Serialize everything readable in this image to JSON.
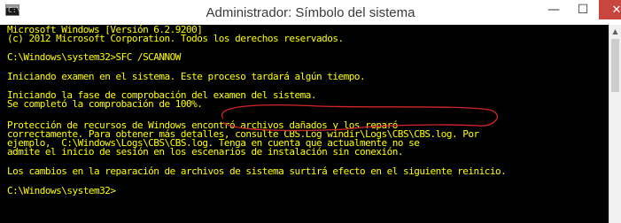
{
  "window": {
    "title": "Administrador: Símbolo del sistema",
    "icon_glyph": "C:\\",
    "minimize_glyph": "—",
    "maximize_glyph": "☐",
    "close_glyph": "✕"
  },
  "console": {
    "text_color": "#ffff00",
    "background_color": "#000000",
    "lines": [
      "Microsoft Windows [Versión 6.2.9200]",
      "(c) 2012 Microsoft Corporation. Todos los derechos reservados.",
      "C:\\Windows\\system32>SFC /SCANNOW",
      "Iniciando examen en el sistema. Este proceso tardará algún tiempo.",
      "Iniciando la fase de comprobación del examen del sistema.",
      "Se completó la comprobación de 100%.",
      "Protección de recursos de Windows encontró archivos dañados y los reparó",
      "correctamente. Para obtener más detalles, consulte CBS.Log windir\\Logs\\CBS\\CBS.log. Por",
      "ejemplo,  C:\\Windows\\Logs\\CBS\\CBS.log. Tenga en cuenta que actualmente no se",
      "admite el inicio de sesión en los escenarios de instalación sin conexión.",
      "Los cambios en la reparación de archivos de sistema surtirá efecto en el siguiente reinicio.",
      "C:\\Windows\\system32>"
    ]
  },
  "annotation": {
    "color": "#d6262b"
  }
}
